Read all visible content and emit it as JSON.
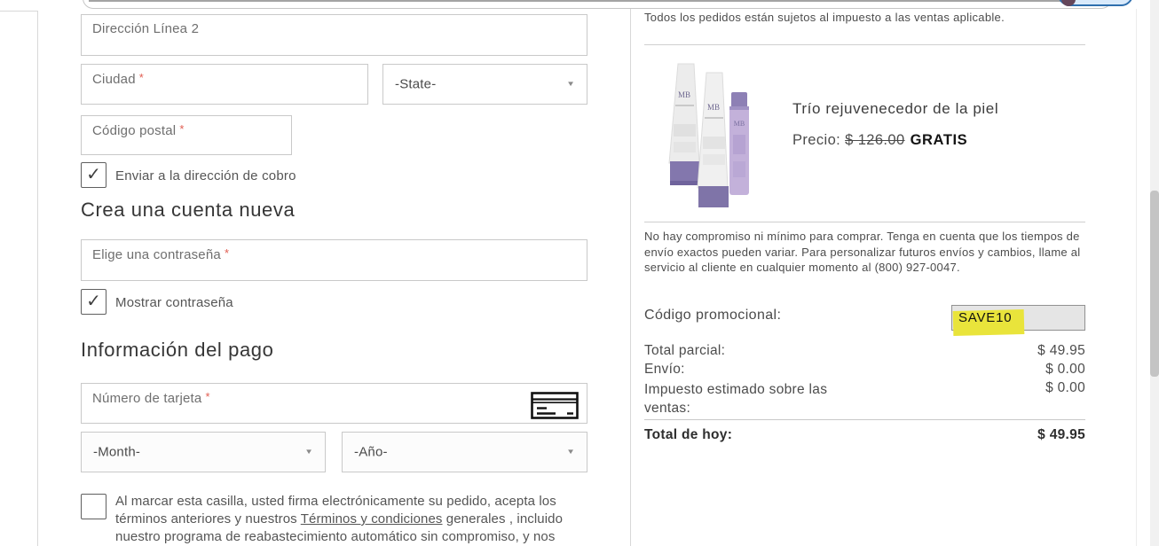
{
  "icons": {
    "checkmark": "✓",
    "dropdown_caret": "▼"
  },
  "form": {
    "required_mark": "*",
    "address2_placeholder": "Dirección Línea 2",
    "city_label": "Ciudad",
    "state_value": "-State-",
    "zip_label": "Código postal",
    "ship_to_billing_label": "Enviar a la dirección de cobro",
    "account_heading": "Crea una cuenta nueva",
    "password_label": "Elige una contraseña",
    "show_password_label": "Mostrar contraseña",
    "payment_heading": "Información del pago",
    "card_number_label": "Número de tarjeta",
    "month_value": "-Month-",
    "year_value": "-Año-",
    "terms_before_link": "Al marcar esta casilla, usted firma electrónicamente su pedido, acepta los términos anteriores y nuestros ",
    "terms_link": "Términos y condiciones",
    "terms_after_link": " generales , incluido nuestro programa de reabastecimiento automático sin compromiso, y nos"
  },
  "summary": {
    "tax_note": "Todos los pedidos están sujetos al impuesto a las ventas aplicable.",
    "product": {
      "name": "Trío rejuvenecedor de la piel",
      "price_label": "Precio:",
      "original_price": "$ 126.00",
      "free_label": "GRATIS"
    },
    "disclaimer": "No hay compromiso ni mínimo para comprar. Tenga en cuenta que los tiempos de envío exactos pueden variar. Para personalizar futuros envíos y cambios, llame al servicio al cliente en cualquier momento al (800) 927-0047.",
    "promo_label": "Código promocional:",
    "promo_value": "SAVE10",
    "totals": [
      {
        "label": "Total parcial:",
        "value": "$ 49.95"
      },
      {
        "label": "Envío:",
        "value": "$ 0.00"
      },
      {
        "label": "Impuesto estimado sobre las ventas:",
        "value": "$ 0.00"
      }
    ],
    "grand_total": {
      "label": "Total de hoy:",
      "value": "$ 49.95"
    }
  },
  "colors": {
    "accent_purple": "#8377ad",
    "highlight_yellow": "#e9e43b",
    "required_red": "#e15d51",
    "pill_blue_border": "#2f6fae"
  }
}
